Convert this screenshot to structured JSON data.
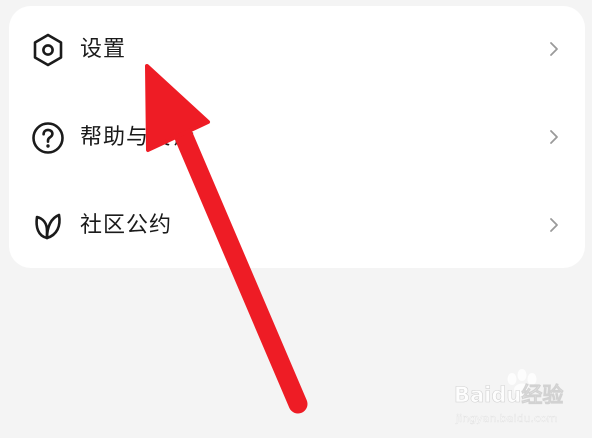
{
  "menu": {
    "items": [
      {
        "label": "设置",
        "icon": "hexagon-settings-icon"
      },
      {
        "label": "帮助与反馈",
        "icon": "question-circle-icon"
      },
      {
        "label": "社区公约",
        "icon": "leaf-icon"
      }
    ]
  },
  "annotation": {
    "arrow_color": "#ee1c25"
  },
  "watermark": {
    "brand": "Baidu经验",
    "url": "jingyan.baidu.com"
  }
}
